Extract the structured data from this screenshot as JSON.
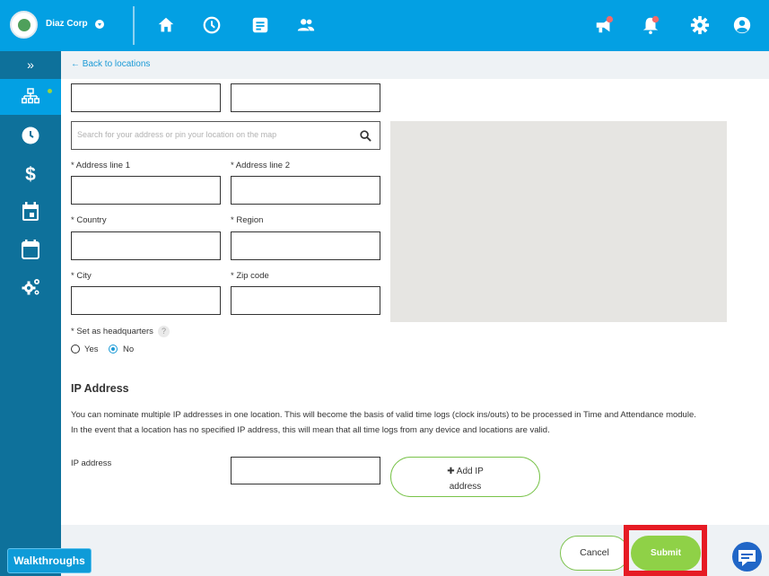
{
  "topbar": {
    "company_name": "Diaz Corp",
    "icons": [
      "home-icon",
      "clock-icon",
      "document-icon",
      "people-icon",
      "megaphone-icon",
      "bell-icon",
      "gear-icon",
      "user-icon"
    ]
  },
  "sidebar": {
    "toggle_label": "»",
    "items": [
      "org-chart-icon",
      "clock-icon",
      "dollar-icon",
      "calendar-icon",
      "calendar-grid-icon",
      "settings-icon"
    ]
  },
  "subheader": {
    "back_label": "← Back to locations"
  },
  "form": {
    "search_placeholder": "Search for your address or pin your location on the map",
    "address_line_1_label": "* Address line 1",
    "address_line_2_label": "* Address line 2",
    "country_label": "* Country",
    "region_label": "* Region",
    "city_label": "* City",
    "zip_label": "* Zip code",
    "headquarters_label": "* Set as headquarters",
    "help_label": "?",
    "yes_label": "Yes",
    "no_label": "No",
    "headquarters_value": "No"
  },
  "ip_section": {
    "title": "IP Address",
    "description": "You can nominate multiple IP addresses in one location. This will become the basis of valid time logs (clock ins/outs) to be processed in Time and Attendance module. In the event that a location has no specified IP address, this will mean that all time logs from any device and locations are valid.",
    "ip_label": "IP address",
    "add_ip_label_line1": "✚ Add IP",
    "add_ip_label_line2": "address"
  },
  "footer": {
    "cancel_label": "Cancel",
    "submit_label": "Submit"
  },
  "walkthroughs_label": "Walkthroughs",
  "colors": {
    "topbar": "#03a0e3",
    "sidebar": "#0e719b",
    "accent_green": "#8fd147",
    "highlight_red": "#e61b24"
  }
}
